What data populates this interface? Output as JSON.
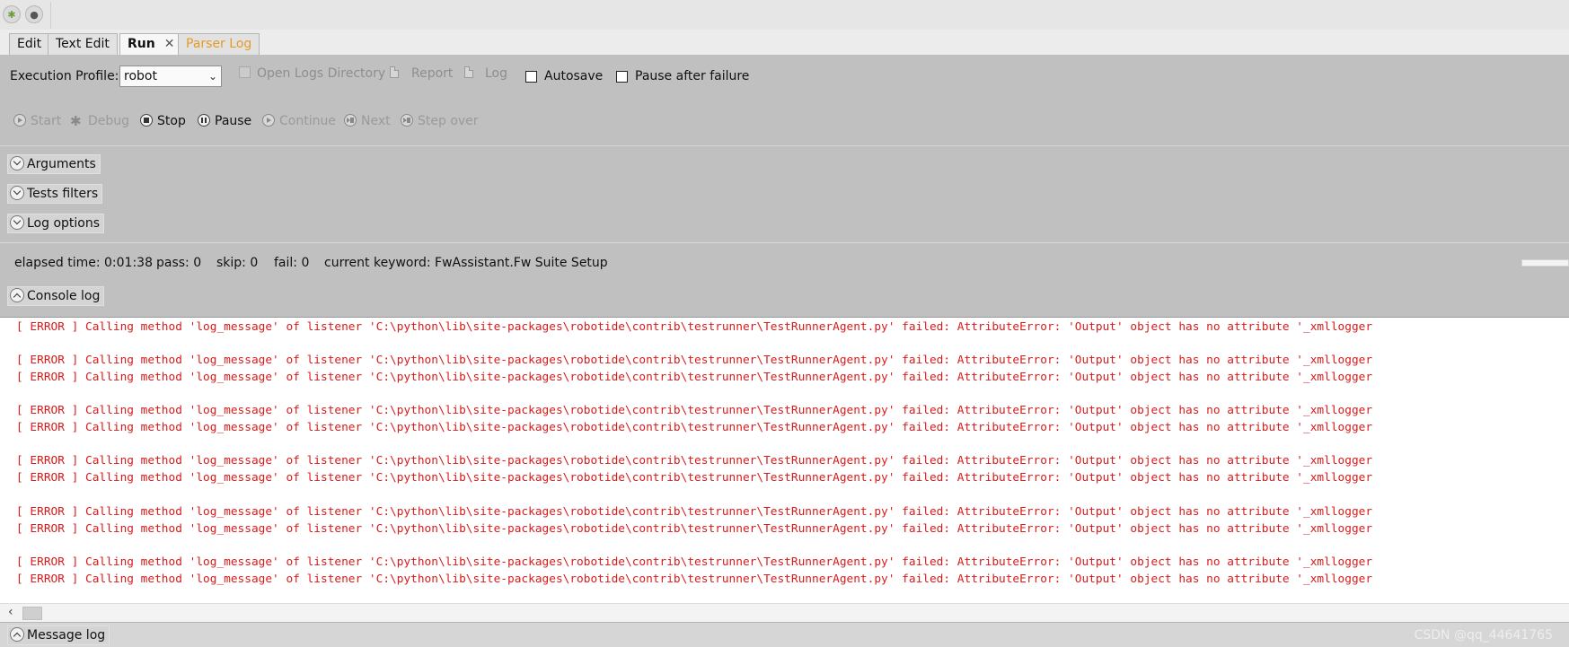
{
  "tabs": [
    {
      "label": "Edit",
      "active": false
    },
    {
      "label": "Text Edit",
      "active": false
    },
    {
      "label": "Run",
      "active": true,
      "close": "✕"
    },
    {
      "label": "Parser Log",
      "active": false,
      "color": "#e59a2a"
    }
  ],
  "profile": {
    "label": "Execution Profile:",
    "selected": "robot",
    "open_logs": "Open Logs Directory",
    "report": "Report",
    "log": "Log",
    "autosave": "Autosave",
    "pause_after_failure": "Pause after failure"
  },
  "run_controls": {
    "start": "Start",
    "debug": "Debug",
    "stop": "Stop",
    "pause": "Pause",
    "continue": "Continue",
    "next": "Next",
    "step_over": "Step over"
  },
  "sections": {
    "arguments": "Arguments",
    "tests_filters": "Tests filters",
    "log_options": "Log options",
    "console_log": "Console log",
    "message_log": "Message log"
  },
  "status": {
    "elapsed": "elapsed time: 0:01:38",
    "pass": "pass: 0",
    "skip": "skip: 0",
    "fail": "fail: 0",
    "keyword": "current keyword: FwAssistant.Fw Suite Setup"
  },
  "console_lines": [
    "[ ERROR ] Calling method 'log_message' of listener 'C:\\python\\lib\\site-packages\\robotide\\contrib\\testrunner\\TestRunnerAgent.py' failed: AttributeError: 'Output' object has no attribute '_xmllogger",
    "",
    "[ ERROR ] Calling method 'log_message' of listener 'C:\\python\\lib\\site-packages\\robotide\\contrib\\testrunner\\TestRunnerAgent.py' failed: AttributeError: 'Output' object has no attribute '_xmllogger",
    "[ ERROR ] Calling method 'log_message' of listener 'C:\\python\\lib\\site-packages\\robotide\\contrib\\testrunner\\TestRunnerAgent.py' failed: AttributeError: 'Output' object has no attribute '_xmllogger",
    "",
    "[ ERROR ] Calling method 'log_message' of listener 'C:\\python\\lib\\site-packages\\robotide\\contrib\\testrunner\\TestRunnerAgent.py' failed: AttributeError: 'Output' object has no attribute '_xmllogger",
    "[ ERROR ] Calling method 'log_message' of listener 'C:\\python\\lib\\site-packages\\robotide\\contrib\\testrunner\\TestRunnerAgent.py' failed: AttributeError: 'Output' object has no attribute '_xmllogger",
    "",
    "[ ERROR ] Calling method 'log_message' of listener 'C:\\python\\lib\\site-packages\\robotide\\contrib\\testrunner\\TestRunnerAgent.py' failed: AttributeError: 'Output' object has no attribute '_xmllogger",
    "[ ERROR ] Calling method 'log_message' of listener 'C:\\python\\lib\\site-packages\\robotide\\contrib\\testrunner\\TestRunnerAgent.py' failed: AttributeError: 'Output' object has no attribute '_xmllogger",
    "",
    "[ ERROR ] Calling method 'log_message' of listener 'C:\\python\\lib\\site-packages\\robotide\\contrib\\testrunner\\TestRunnerAgent.py' failed: AttributeError: 'Output' object has no attribute '_xmllogger",
    "[ ERROR ] Calling method 'log_message' of listener 'C:\\python\\lib\\site-packages\\robotide\\contrib\\testrunner\\TestRunnerAgent.py' failed: AttributeError: 'Output' object has no attribute '_xmllogger",
    "",
    "[ ERROR ] Calling method 'log_message' of listener 'C:\\python\\lib\\site-packages\\robotide\\contrib\\testrunner\\TestRunnerAgent.py' failed: AttributeError: 'Output' object has no attribute '_xmllogger",
    "[ ERROR ] Calling method 'log_message' of listener 'C:\\python\\lib\\site-packages\\robotide\\contrib\\testrunner\\TestRunnerAgent.py' failed: AttributeError: 'Output' object has no attribute '_xmllogger"
  ],
  "watermark": "CSDN @qq_44641765",
  "colors": {
    "error_text": "#d81b1b",
    "parser_log_tab": "#e59a2a",
    "panel_bg": "#c0c0c0"
  }
}
